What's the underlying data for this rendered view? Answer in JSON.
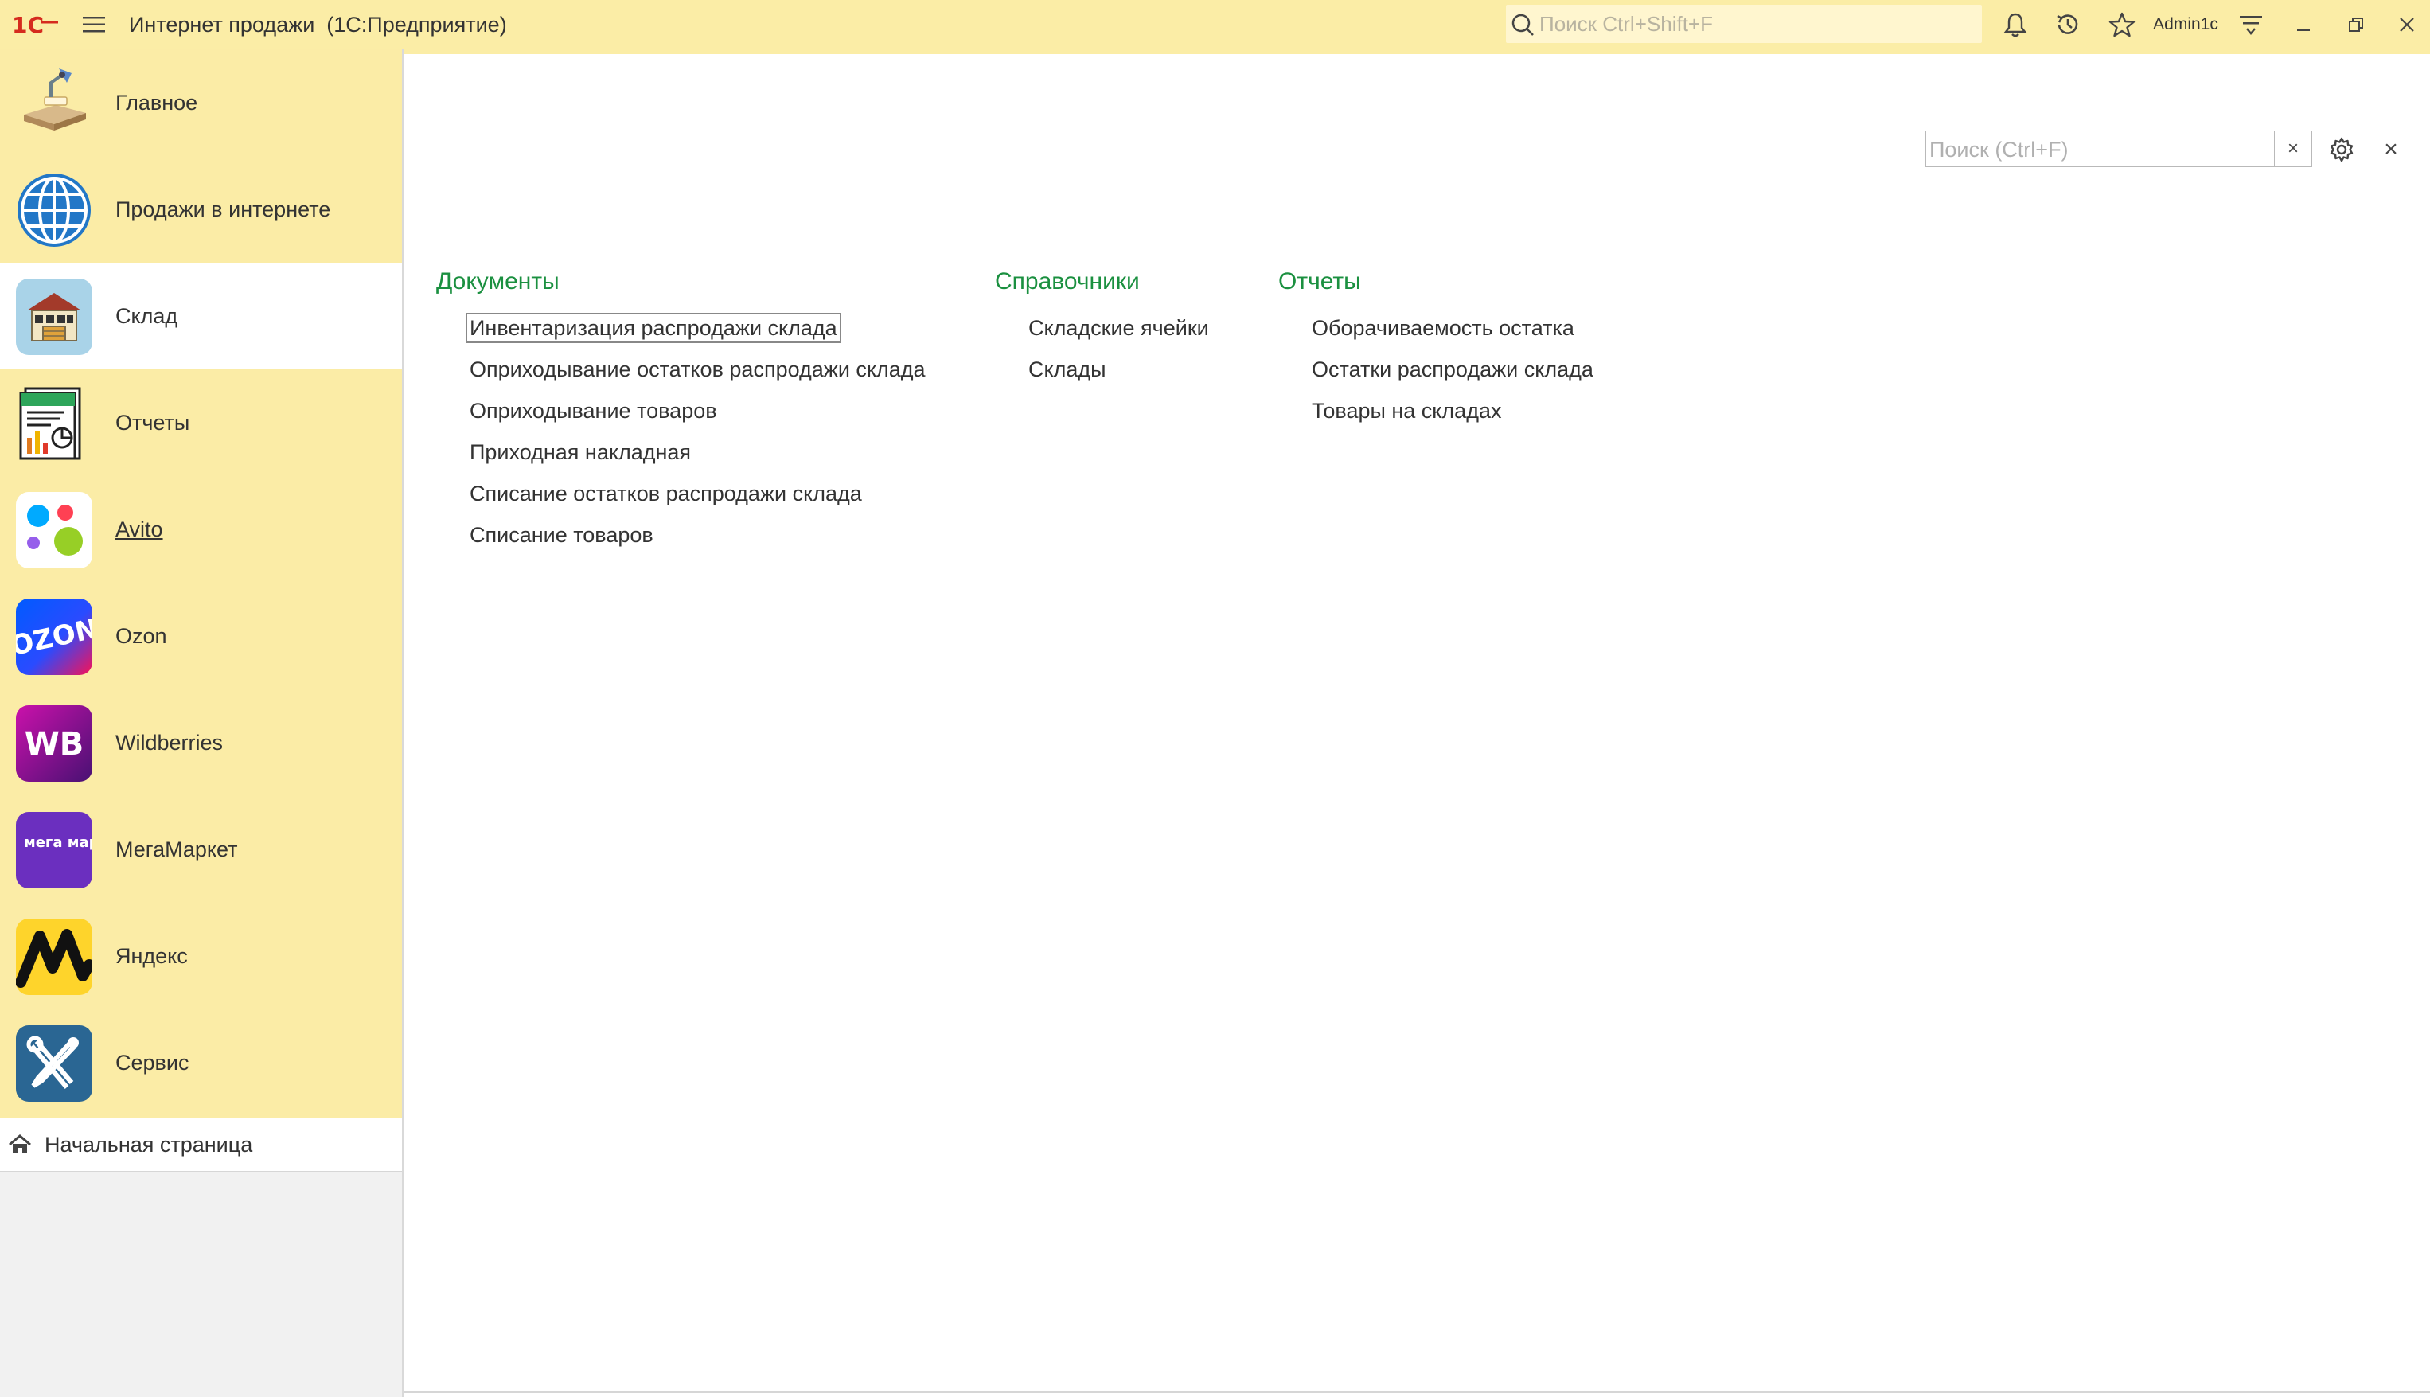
{
  "topbar": {
    "logo": "1C",
    "title": "Интернет продажи  (1С:Предприятие)",
    "search_placeholder": "Поиск Ctrl+Shift+F",
    "user": "Admin1c"
  },
  "sidebar": {
    "sections": [
      {
        "label": "Главное",
        "icon": "desk-lamp-icon"
      },
      {
        "label": "Продажи в интернете",
        "icon": "globe-icon"
      },
      {
        "label": "Склад",
        "icon": "warehouse-icon",
        "active": true
      },
      {
        "label": "Отчеты",
        "icon": "report-chart-icon"
      },
      {
        "label": "Avito",
        "icon": "avito-logo-icon"
      },
      {
        "label": "Ozon",
        "icon": "ozon-logo-icon",
        "logo_text": "OZON"
      },
      {
        "label": "Wildberries",
        "icon": "wb-logo-icon",
        "logo_text": "WB"
      },
      {
        "label": "МегаМаркет",
        "icon": "megamarket-logo-icon",
        "logo_text": "мега маркет"
      },
      {
        "label": "Яндекс",
        "icon": "yandex-market-icon"
      },
      {
        "label": "Сервис",
        "icon": "tools-icon"
      }
    ],
    "home_label": "Начальная страница"
  },
  "content": {
    "search_placeholder": "Поиск (Ctrl+F)",
    "clear_symbol": "×",
    "close_symbol": "×",
    "columns": [
      {
        "title": "Документы",
        "links": [
          "Инвентаризация распродажи склада",
          "Оприходывание остатков распродажи склада",
          "Оприходывание товаров",
          "Приходная накладная",
          "Списание остатков распродажи склада",
          "Списание товаров"
        ]
      },
      {
        "title": "Справочники",
        "links": [
          "Складские ячейки",
          "Склады"
        ]
      },
      {
        "title": "Отчеты",
        "links": [
          "Оборачиваемость остатка",
          "Остатки распродажи склада",
          "Товары на складах"
        ]
      }
    ]
  },
  "colors": {
    "topbar_bg": "#fbeda6",
    "sidebar_bg": "#fbeca6",
    "section_title": "#1b9040",
    "text": "#333333"
  }
}
